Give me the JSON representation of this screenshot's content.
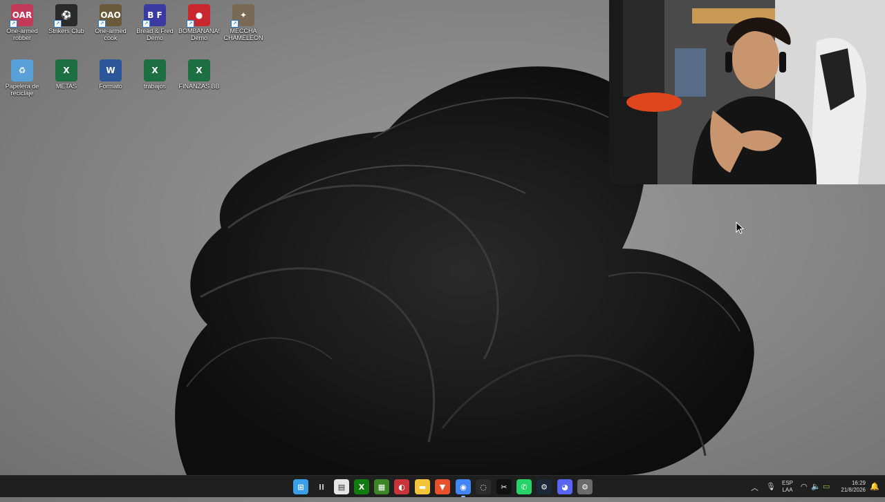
{
  "desktop": {
    "icons": [
      {
        "label": "One-armed robber",
        "glyph": "OAR",
        "color": "#c23a5a"
      },
      {
        "label": "Strikers Club",
        "glyph": "⚽",
        "color": "#2a2a2a"
      },
      {
        "label": "One-armed cook",
        "glyph": "OAO",
        "color": "#6b5a3a"
      },
      {
        "label": "Bread & Fred Demo",
        "glyph": "B F",
        "color": "#3a3aa0"
      },
      {
        "label": "BOMBANANA! Demo",
        "glyph": "●",
        "color": "#c8282d"
      },
      {
        "label": "MECCHA CHAMELEON",
        "glyph": "✦",
        "color": "#7a6a55"
      },
      {
        "label": "Papelera de reciclaje",
        "glyph": "♻",
        "color": "#5aa0d8"
      },
      {
        "label": "METAS",
        "glyph": "X",
        "color": "#1d6f42"
      },
      {
        "label": "Formato",
        "glyph": "W",
        "color": "#2b579a"
      },
      {
        "label": "trabajos",
        "glyph": "X",
        "color": "#1d6f42"
      },
      {
        "label": "FINANZAS BB",
        "glyph": "X",
        "color": "#1d6f42"
      }
    ]
  },
  "taskbar": {
    "apps": [
      {
        "name": "start",
        "glyph": "⊞",
        "color": "#3b9fe8"
      },
      {
        "name": "task-view",
        "glyph": "⁞⁞",
        "color": "#1f1f1f"
      },
      {
        "name": "store",
        "glyph": "▤",
        "color": "#e6e6e6"
      },
      {
        "name": "xbox",
        "glyph": "X",
        "color": "#107c10"
      },
      {
        "name": "minecraft",
        "glyph": "▦",
        "color": "#3c8527"
      },
      {
        "name": "paint",
        "glyph": "◐",
        "color": "#c8343a"
      },
      {
        "name": "file-explorer",
        "glyph": "▬",
        "color": "#f3c33a"
      },
      {
        "name": "brave",
        "glyph": "▼",
        "color": "#e8512b"
      },
      {
        "name": "chrome",
        "glyph": "◉",
        "color": "#4285f4"
      },
      {
        "name": "obs",
        "glyph": "◌",
        "color": "#2b2b2b"
      },
      {
        "name": "capcut",
        "glyph": "✂",
        "color": "#111111"
      },
      {
        "name": "whatsapp",
        "glyph": "✆",
        "color": "#25d366"
      },
      {
        "name": "steam",
        "glyph": "⚙",
        "color": "#1b2838"
      },
      {
        "name": "discord",
        "glyph": "◕",
        "color": "#5865f2"
      },
      {
        "name": "settings",
        "glyph": "⚙",
        "color": "#6a6a6a"
      }
    ],
    "tray": {
      "lang_top": "ESP",
      "lang_bottom": "LAA",
      "time": "16:29",
      "date": "21/8/2026"
    }
  }
}
